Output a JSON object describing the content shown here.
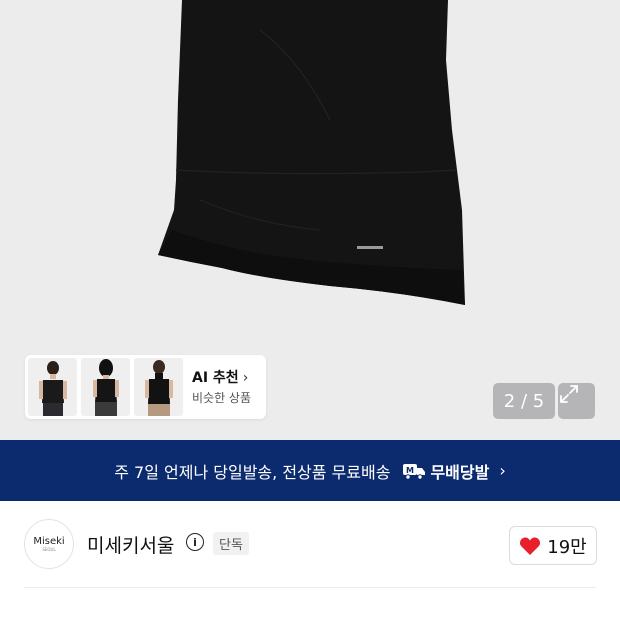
{
  "ai_recommend": {
    "title": "AI 추천",
    "chevron": "›",
    "subtitle": "비슷한 상품"
  },
  "gallery": {
    "counter": "2 / 5"
  },
  "banner": {
    "text": "주 7일 언제나 당일발송, 전상품 무료배송",
    "badge_label": "무배당발",
    "chevron": "›"
  },
  "seller": {
    "logo_text": "Miseki",
    "logo_sub": "SEOUL",
    "name": "미세키서울",
    "info_glyph": "i",
    "badge": "단독",
    "like_count": "19만"
  },
  "colors": {
    "banner_bg": "#0c2a6e",
    "heart": "#e8202a",
    "hero_bg": "#ececed"
  }
}
